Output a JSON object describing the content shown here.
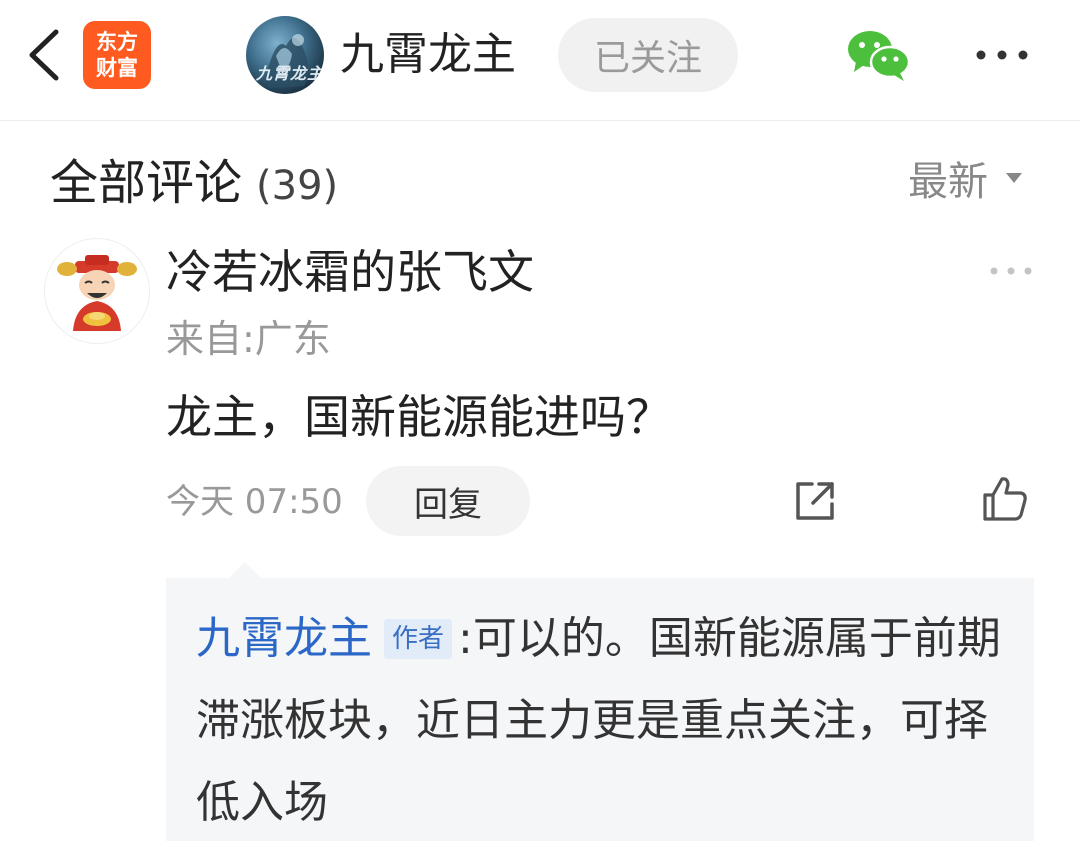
{
  "header": {
    "back_icon": "chevron-left-icon",
    "app_badge": {
      "line1": "东方",
      "line2": "财富",
      "color": "#ff5a1f"
    },
    "author_name": "九霄龙主",
    "follow_label": "已关注",
    "share_wechat_icon": "wechat-icon",
    "more_icon": "more-horizontal-icon"
  },
  "comments_section": {
    "title": "全部评论",
    "count": "(39)",
    "sort_label": "最新",
    "sort_icon": "caret-down-icon"
  },
  "comment": {
    "user_name": "冷若冰霜的张飞文",
    "location": "来自:广东",
    "body": "龙主，国新能源能进吗？",
    "time": "今天 07:50",
    "reply_label": "回复",
    "share_icon": "share-icon",
    "like_icon": "thumbs-up-icon",
    "more_icon": "more-horizontal-icon"
  },
  "reply": {
    "author": "九霄龙主",
    "author_tag": "作者",
    "separator": ":",
    "text": "可以的。国新能源属于前期滞涨板块，近日主力更是重点关注，可择低入场",
    "author_color": "#2a67c6"
  }
}
